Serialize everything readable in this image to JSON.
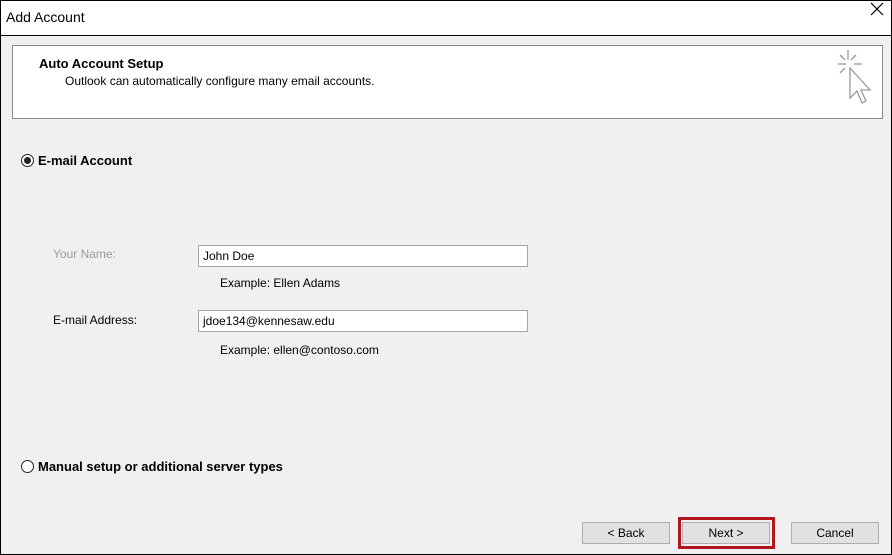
{
  "window": {
    "title": "Add Account"
  },
  "header": {
    "title": "Auto Account Setup",
    "subtitle": "Outlook can automatically configure many email accounts."
  },
  "options": {
    "email_account": {
      "label": "E-mail Account",
      "selected": true
    },
    "manual_setup": {
      "label": "Manual setup or additional server types",
      "selected": false
    }
  },
  "form": {
    "your_name": {
      "label": "Your Name:",
      "value": "John Doe",
      "example": "Example: Ellen Adams"
    },
    "email_address": {
      "label": "E-mail Address:",
      "value": "jdoe134@kennesaw.edu",
      "example": "Example: ellen@contoso.com"
    }
  },
  "buttons": {
    "back": "< Back",
    "next": "Next >",
    "cancel": "Cancel"
  },
  "colors": {
    "highlight": "#b3161f",
    "dialog_background": "#f0f0f0"
  },
  "icons": {
    "close": "close-icon",
    "header": "cursor-sparkle-icon"
  }
}
